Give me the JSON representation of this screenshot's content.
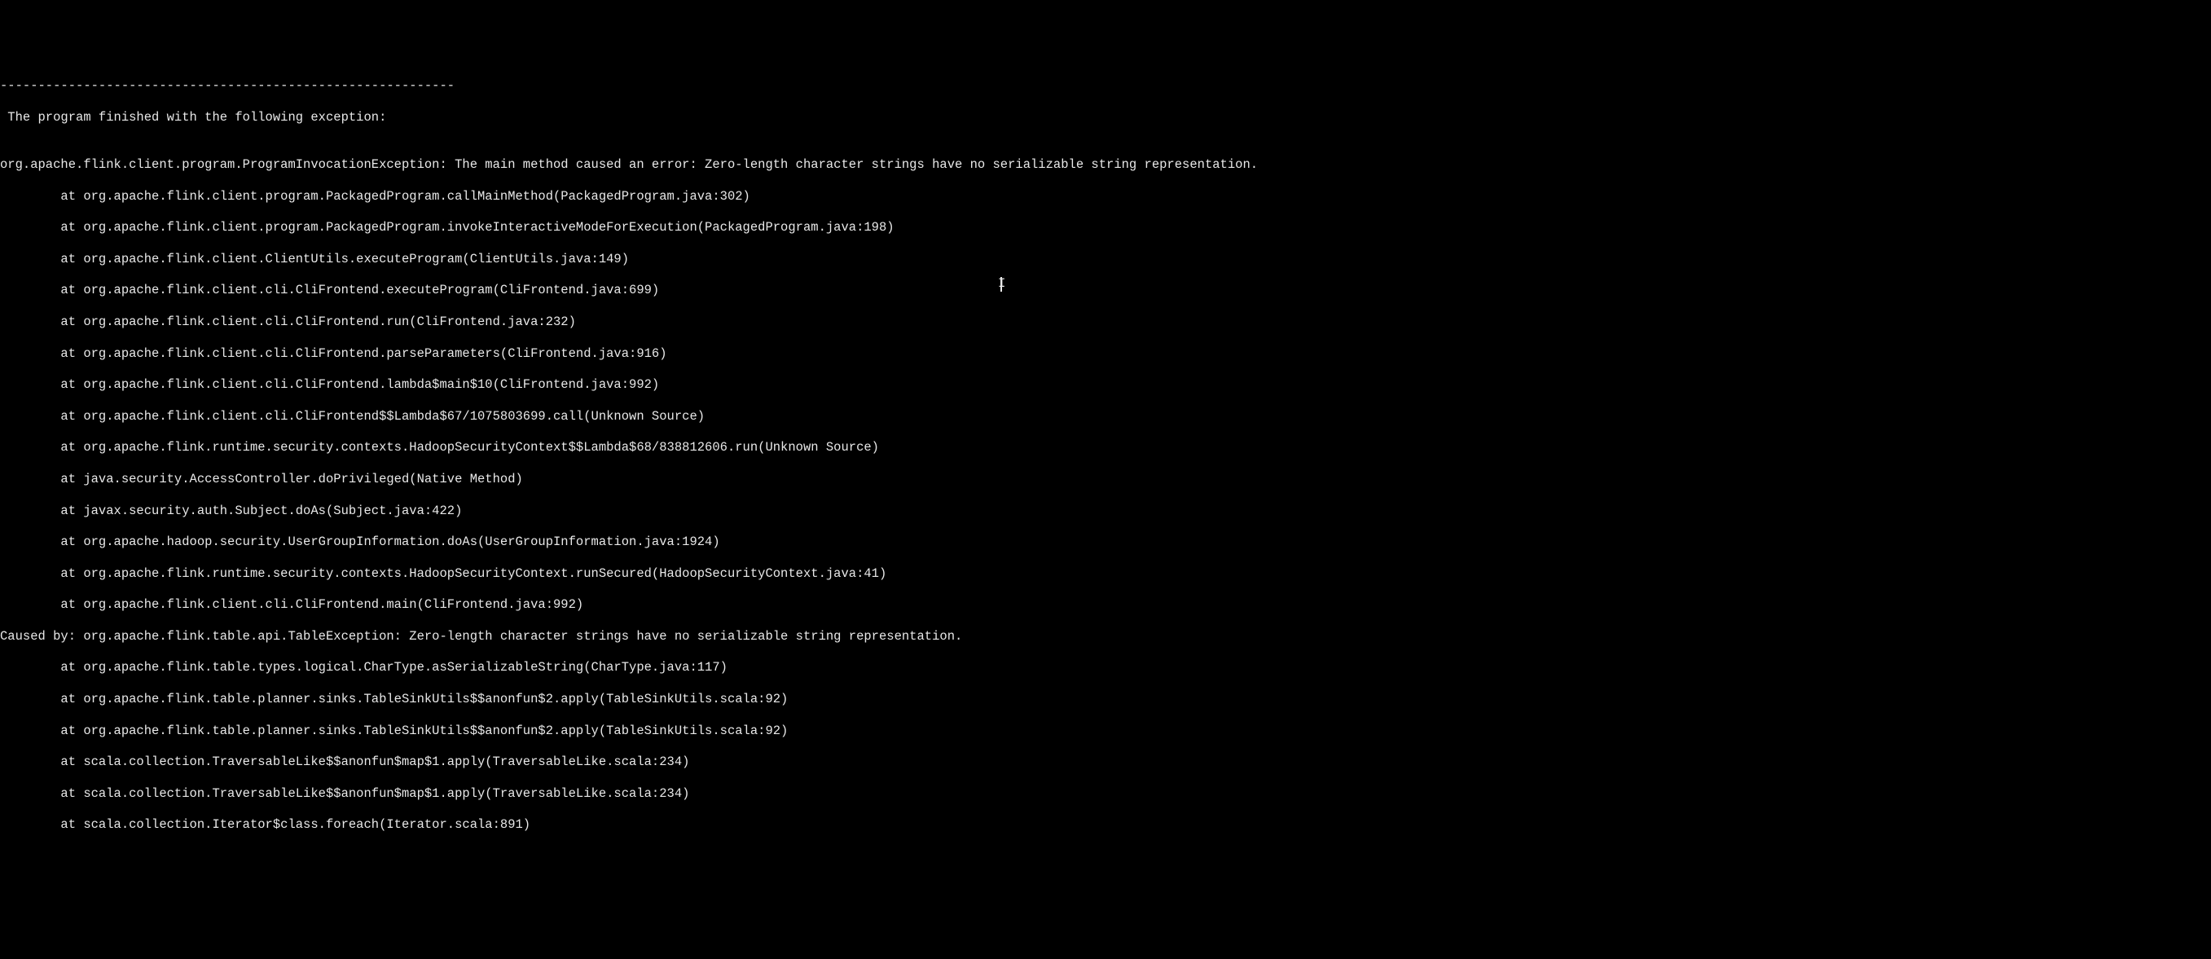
{
  "console": {
    "separator": "------------------------------------------------------------",
    "header": " The program finished with the following exception:",
    "blank": "",
    "exception_line": "org.apache.flink.client.program.ProgramInvocationException: The main method caused an error: Zero-length character strings have no serializable string representation.",
    "stack": [
      "        at org.apache.flink.client.program.PackagedProgram.callMainMethod(PackagedProgram.java:302)",
      "        at org.apache.flink.client.program.PackagedProgram.invokeInteractiveModeForExecution(PackagedProgram.java:198)",
      "        at org.apache.flink.client.ClientUtils.executeProgram(ClientUtils.java:149)",
      "        at org.apache.flink.client.cli.CliFrontend.executeProgram(CliFrontend.java:699)",
      "        at org.apache.flink.client.cli.CliFrontend.run(CliFrontend.java:232)",
      "        at org.apache.flink.client.cli.CliFrontend.parseParameters(CliFrontend.java:916)",
      "        at org.apache.flink.client.cli.CliFrontend.lambda$main$10(CliFrontend.java:992)",
      "        at org.apache.flink.client.cli.CliFrontend$$Lambda$67/1075803699.call(Unknown Source)",
      "        at org.apache.flink.runtime.security.contexts.HadoopSecurityContext$$Lambda$68/838812606.run(Unknown Source)",
      "        at java.security.AccessController.doPrivileged(Native Method)",
      "        at javax.security.auth.Subject.doAs(Subject.java:422)",
      "        at org.apache.hadoop.security.UserGroupInformation.doAs(UserGroupInformation.java:1924)",
      "        at org.apache.flink.runtime.security.contexts.HadoopSecurityContext.runSecured(HadoopSecurityContext.java:41)",
      "        at org.apache.flink.client.cli.CliFrontend.main(CliFrontend.java:992)"
    ],
    "caused_by": "Caused by: org.apache.flink.table.api.TableException: Zero-length character strings have no serializable string representation.",
    "caused_stack": [
      "        at org.apache.flink.table.types.logical.CharType.asSerializableString(CharType.java:117)",
      "        at org.apache.flink.table.planner.sinks.TableSinkUtils$$anonfun$2.apply(TableSinkUtils.scala:92)",
      "        at org.apache.flink.table.planner.sinks.TableSinkUtils$$anonfun$2.apply(TableSinkUtils.scala:92)",
      "        at scala.collection.TraversableLike$$anonfun$map$1.apply(TraversableLike.scala:234)",
      "        at scala.collection.TraversableLike$$anonfun$map$1.apply(TraversableLike.scala:234)",
      "        at scala.collection.Iterator$class.foreach(Iterator.scala:891)"
    ]
  }
}
